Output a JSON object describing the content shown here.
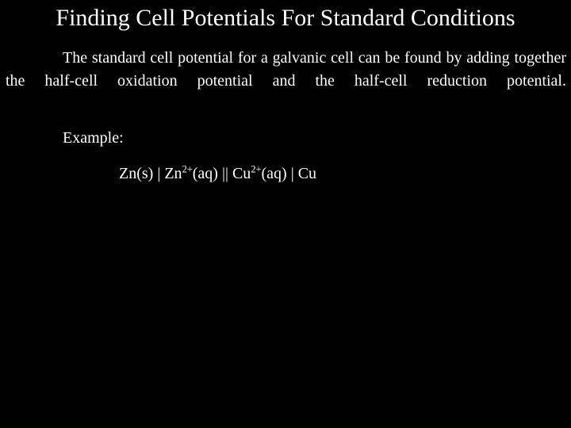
{
  "slide": {
    "background_color": "#000000",
    "text_color": "#ffffff",
    "title": "Finding Cell Potentials For Standard Conditions",
    "paragraph": "The standard cell potential for a galvanic cell can be found by adding together the half-cell oxidation potential and the half-cell reduction potential.",
    "example_label": "Example:",
    "cell_notation": {
      "zinc_electrode": "Zn(s)",
      "separator_single_left": "|",
      "zinc_ion_symbol": "Zn",
      "zinc_ion_charge": "2+",
      "zinc_ion_state": "(aq)",
      "salt_bridge": "||",
      "copper_ion_symbol": "Cu",
      "copper_ion_charge": "2+",
      "copper_ion_state": "(aq)",
      "separator_single_right": "|",
      "copper_electrode": "Cu",
      "full_text": "Zn(s) | Zn2+(aq) || Cu2+(aq) | Cu"
    }
  }
}
